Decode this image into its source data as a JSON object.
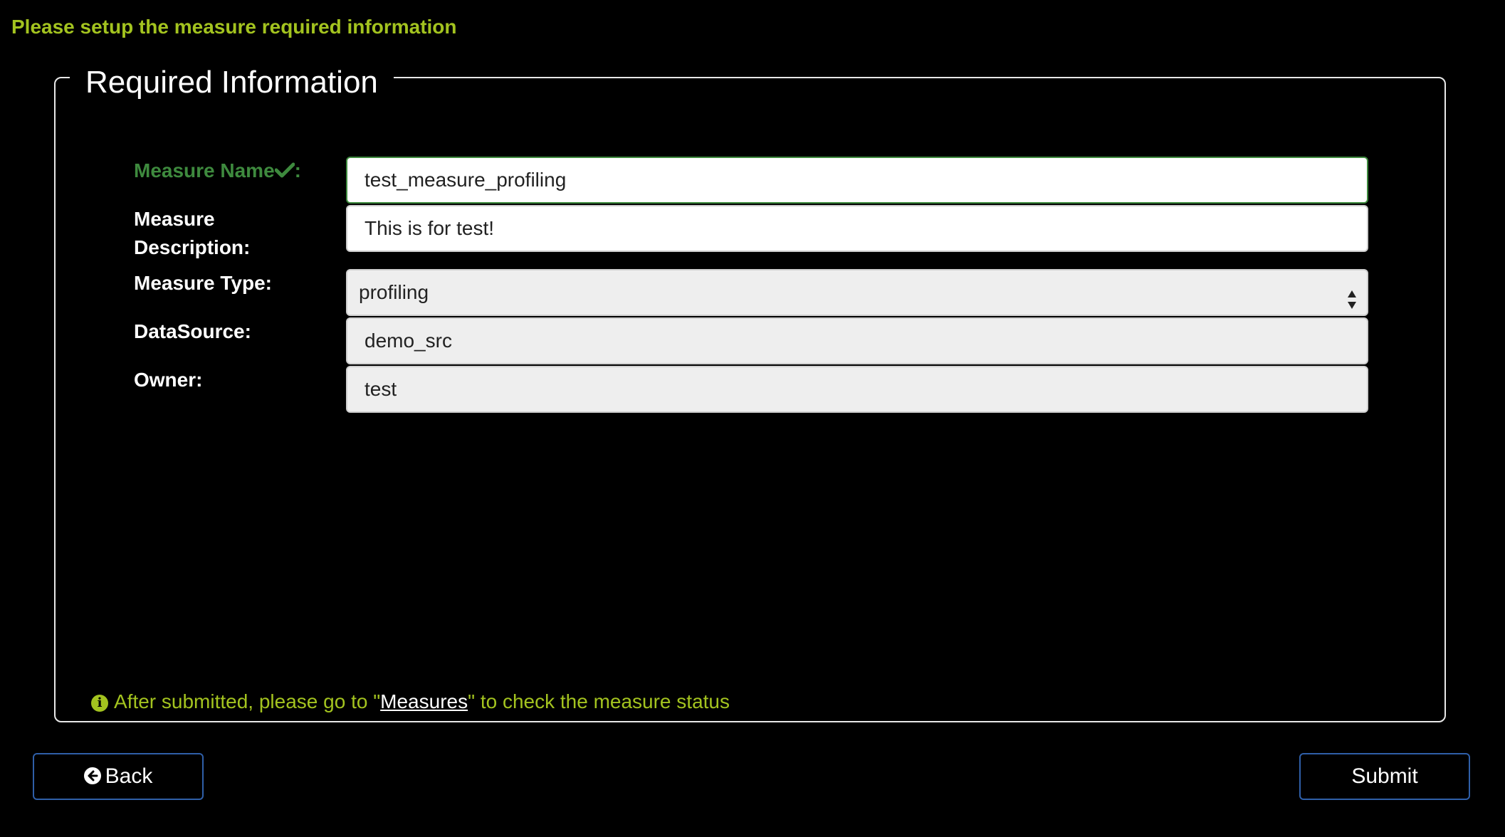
{
  "page": {
    "heading": "Please setup the measure required information"
  },
  "section": {
    "legend": "Required Information"
  },
  "form": {
    "measure_name": {
      "label": "Measure Name",
      "label_suffix": ":",
      "value": "test_measure_profiling",
      "valid": true
    },
    "measure_description": {
      "label": "Measure Description:",
      "value": "This is for test!"
    },
    "measure_type": {
      "label": "Measure Type:",
      "selected": "profiling"
    },
    "datasource": {
      "label": "DataSource:",
      "value": "demo_src"
    },
    "owner": {
      "label": "Owner:",
      "value": "test"
    }
  },
  "info": {
    "prefix": "After submitted, please go to \"",
    "link_text": "Measures",
    "suffix": "\" to check the measure status"
  },
  "buttons": {
    "back_label": "Back",
    "submit_label": "Submit"
  },
  "colors": {
    "accent": "#a3c31f",
    "valid": "#3e8a3e",
    "button_border": "#2f5fa8",
    "background": "#000000"
  },
  "icons": {
    "valid": "checkmark-icon",
    "info": "info-circle-icon",
    "back": "arrow-circle-left-icon",
    "select": "select-arrows-icon"
  }
}
